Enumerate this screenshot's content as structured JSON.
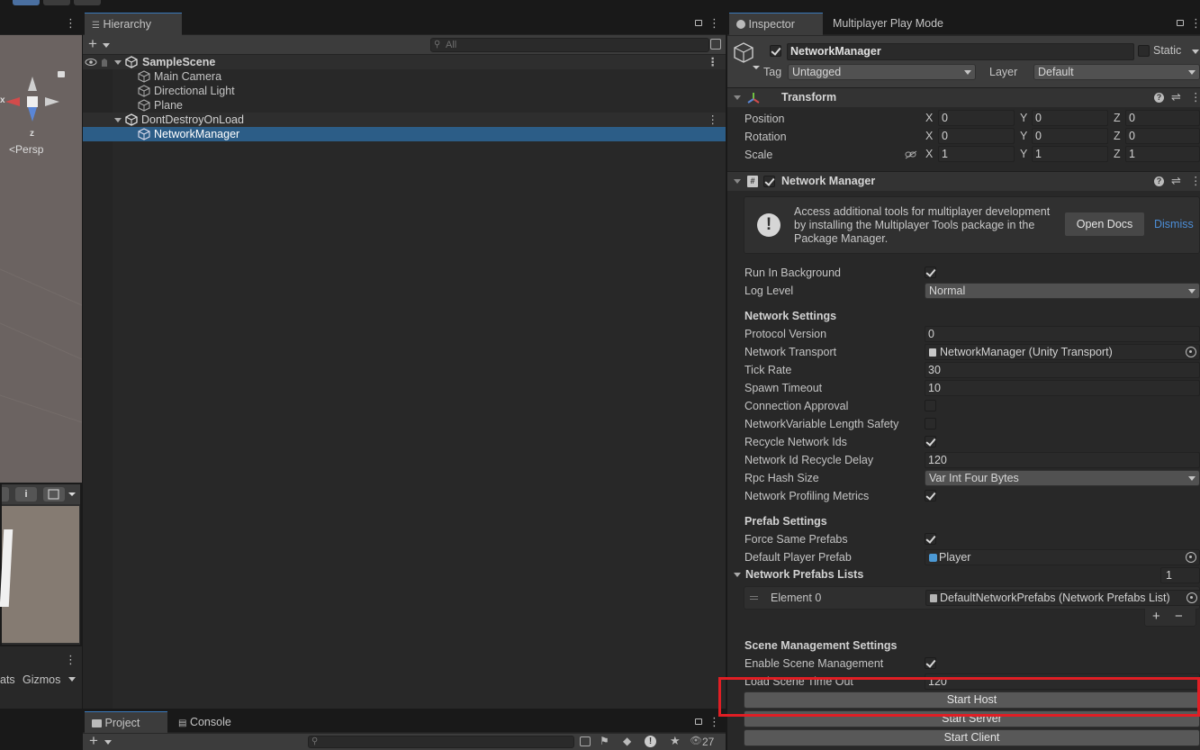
{
  "scene": {
    "view_mode": "Persp",
    "axis_x": "x",
    "axis_z": "z",
    "overlay_stats": "ats",
    "overlay_gizmos": "Gizmos"
  },
  "hierarchy": {
    "tab_label": "Hierarchy",
    "add_label": "+",
    "search_placeholder": "All",
    "items": [
      {
        "label": "SampleScene"
      },
      {
        "label": "Main Camera"
      },
      {
        "label": "Directional Light"
      },
      {
        "label": "Plane"
      },
      {
        "label": "DontDestroyOnLoad"
      },
      {
        "label": "NetworkManager"
      }
    ]
  },
  "project": {
    "tab_project": "Project",
    "tab_console": "Console",
    "hidden_count": "27"
  },
  "inspector": {
    "tab_inspector": "Inspector",
    "tab_multiplayer": "Multiplayer Play Mode",
    "object_name": "NetworkManager",
    "static_label": "Static",
    "tag_label": "Tag",
    "tag_value": "Untagged",
    "layer_label": "Layer",
    "layer_value": "Default",
    "transform": {
      "title": "Transform",
      "position_label": "Position",
      "rotation_label": "Rotation",
      "scale_label": "Scale",
      "x": "X",
      "y": "Y",
      "z": "Z",
      "position": [
        "0",
        "0",
        "0"
      ],
      "rotation": [
        "0",
        "0",
        "0"
      ],
      "scale": [
        "1",
        "1",
        "1"
      ]
    },
    "network_manager": {
      "title": "Network Manager",
      "info_text": "Access additional tools for multiplayer development by installing the Multiplayer Tools package in the Package Manager.",
      "open_docs": "Open Docs",
      "dismiss": "Dismiss",
      "run_in_background": "Run In Background",
      "log_level": "Log Level",
      "log_level_value": "Normal",
      "network_settings": "Network Settings",
      "protocol_version": "Protocol Version",
      "protocol_version_value": "0",
      "network_transport": "Network Transport",
      "network_transport_value": "NetworkManager (Unity Transport)",
      "tick_rate": "Tick Rate",
      "tick_rate_value": "30",
      "spawn_timeout": "Spawn Timeout",
      "spawn_timeout_value": "10",
      "connection_approval": "Connection Approval",
      "nv_length_safety": "NetworkVariable Length Safety",
      "recycle_ids": "Recycle Network Ids",
      "id_recycle_delay": "Network Id Recycle Delay",
      "id_recycle_delay_value": "120",
      "rpc_hash_size": "Rpc Hash Size",
      "rpc_hash_size_value": "Var Int Four Bytes",
      "profiling_metrics": "Network Profiling Metrics",
      "prefab_settings": "Prefab Settings",
      "force_same_prefabs": "Force Same Prefabs",
      "default_player_prefab": "Default Player Prefab",
      "default_player_prefab_value": "Player",
      "prefabs_lists": "Network Prefabs Lists",
      "prefabs_lists_count": "1",
      "element0": "Element 0",
      "element0_value": "DefaultNetworkPrefabs (Network Prefabs List)",
      "list_add": "+",
      "list_remove": "−",
      "scene_mgmt_settings": "Scene Management Settings",
      "enable_scene_mgmt": "Enable Scene Management",
      "load_scene_timeout": "Load Scene Time Out",
      "load_scene_timeout_value": "120",
      "start_host": "Start Host",
      "start_server": "Start Server",
      "start_client": "Start Client"
    }
  }
}
